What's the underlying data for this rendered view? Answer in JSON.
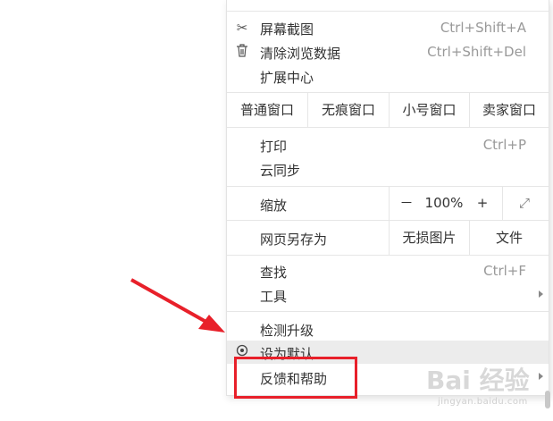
{
  "menu": {
    "screenshot": {
      "label": "屏幕截图",
      "shortcut": "Ctrl+Shift+A",
      "icon": "scissors-icon"
    },
    "clear_data": {
      "label": "清除浏览数据",
      "shortcut": "Ctrl+Shift+Del",
      "icon": "trash-icon"
    },
    "extensions": {
      "label": "扩展中心"
    },
    "windows": [
      "普通窗口",
      "无痕窗口",
      "小号窗口",
      "卖家窗口"
    ],
    "print": {
      "label": "打印",
      "shortcut": "Ctrl+P"
    },
    "cloud_sync": {
      "label": "云同步"
    },
    "zoom": {
      "label": "缩放",
      "minus": "－",
      "value": "100%",
      "plus": "+",
      "fullscreen": "⤢"
    },
    "save_as": {
      "label": "网页另存为",
      "no_image": "无损图片",
      "file": "文件"
    },
    "find": {
      "label": "查找",
      "shortcut": "Ctrl+F"
    },
    "tools": {
      "label": "工具"
    },
    "check_update": {
      "label": "检测升级"
    },
    "set_default": {
      "label": "设为默认",
      "icon": "target-icon"
    },
    "feedback": {
      "label": "反馈和帮助"
    }
  },
  "watermark": {
    "text": "Bai 经验",
    "sub": "jingyan.baidu.com"
  },
  "colors": {
    "annotation_red": "#e8202a"
  }
}
